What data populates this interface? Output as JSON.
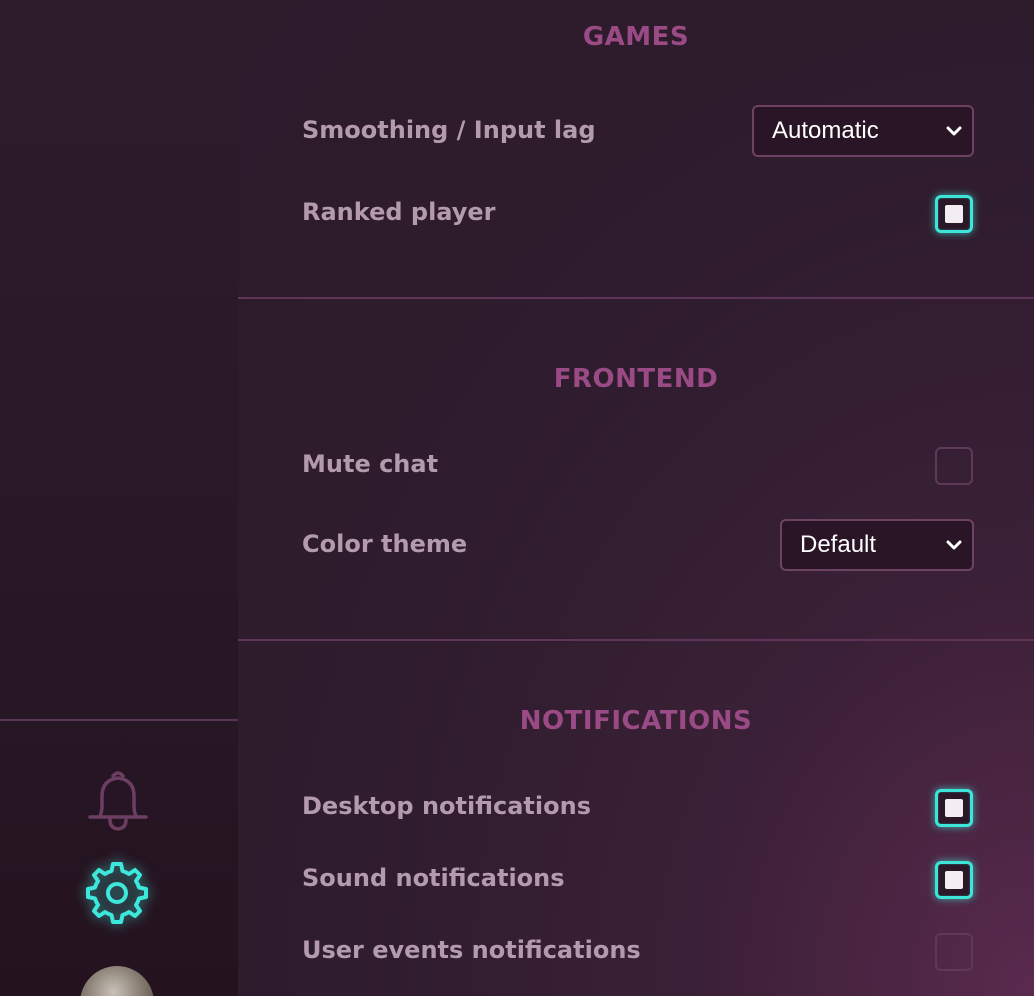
{
  "sidebar": {
    "icons": [
      "bell-icon",
      "gear-icon"
    ],
    "accent_color": "#3de7db"
  },
  "sections": {
    "games": {
      "title": "GAMES",
      "smoothing": {
        "label": "Smoothing / Input lag",
        "value": "Automatic"
      },
      "ranked": {
        "label": "Ranked player",
        "checked": true
      }
    },
    "frontend": {
      "title": "FRONTEND",
      "mute_chat": {
        "label": "Mute chat",
        "checked": false
      },
      "color_theme": {
        "label": "Color theme",
        "value": "Default"
      }
    },
    "notifications": {
      "title": "NOTIFICATIONS",
      "desktop": {
        "label": "Desktop notifications",
        "checked": true
      },
      "sound": {
        "label": "Sound notifications",
        "checked": true
      },
      "user_events": {
        "label": "User events notifications",
        "checked": false
      }
    }
  },
  "colors": {
    "section_title": "#9a4b85",
    "label": "#b39bad",
    "checkbox_on": "#3fe4d9"
  }
}
